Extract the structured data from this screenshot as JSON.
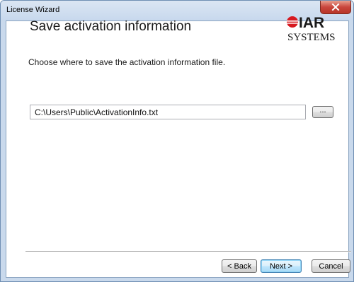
{
  "window": {
    "title": "License Wizard",
    "close_glyph": "x"
  },
  "header": {
    "title": "Save activation information",
    "logo": {
      "line1": "IAR",
      "line2": "SYSTEMS",
      "brand_color": "#d71920"
    }
  },
  "content": {
    "instruction": "Choose where to save the activation information file.",
    "path_input_value": "C:\\Users\\Public\\ActivationInfo.txt",
    "browse_label": "..."
  },
  "footer": {
    "back_label": "< Back",
    "next_label": "Next >",
    "cancel_label": "Cancel"
  },
  "colors": {
    "titlebar": "#c7d8ed",
    "close_button": "#c9463d",
    "default_button_border": "#3c7fb1"
  }
}
